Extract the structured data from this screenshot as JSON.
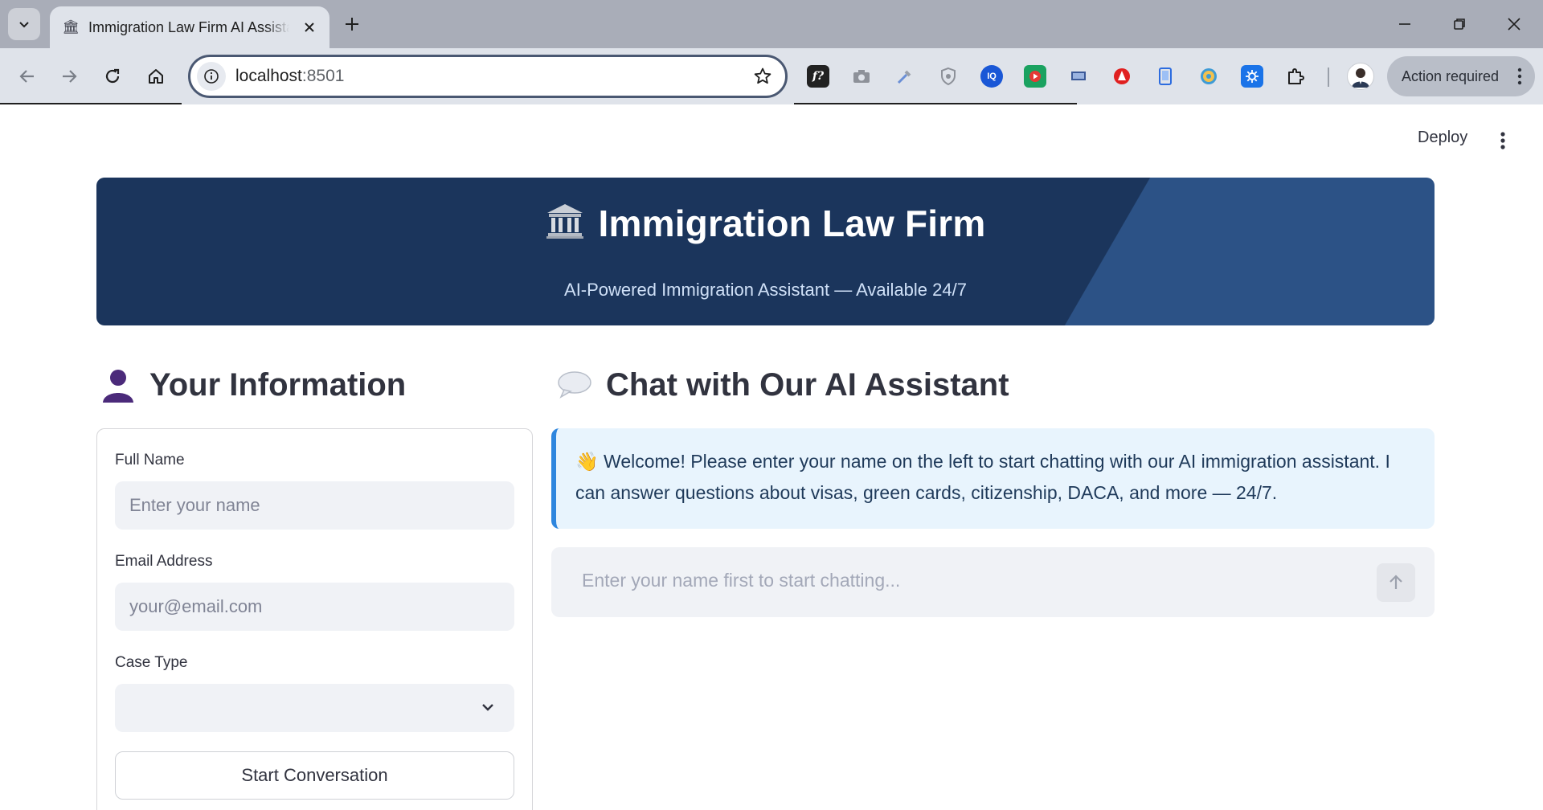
{
  "browser": {
    "tab_title": "Immigration Law Firm AI Assistant",
    "tab_favicon": "🏛",
    "url_host": "localhost",
    "url_port": ":8501",
    "action_required": "Action required",
    "extensions": [
      "formula-extension-icon",
      "camera-extension-icon",
      "eyedropper-extension-icon",
      "shield-extension-icon",
      "iq-extension-icon",
      "video-record-extension-icon",
      "screen-extension-icon",
      "pdf-extension-icon",
      "tablet-extension-icon",
      "cd-extension-icon",
      "gear-extension-icon",
      "puzzle-extensions-icon"
    ]
  },
  "app": {
    "deploy_label": "Deploy"
  },
  "banner": {
    "emoji": "🏛️",
    "title": "Immigration Law Firm",
    "subtitle": "AI-Powered Immigration Assistant — Available 24/7"
  },
  "info_section": {
    "heading": "Your Information",
    "name_label": "Full Name",
    "name_placeholder": "Enter your name",
    "email_label": "Email Address",
    "email_placeholder": "your@email.com",
    "case_label": "Case Type",
    "case_value": "",
    "start_button": "Start Conversation"
  },
  "chat_section": {
    "heading": "Chat with Our AI Assistant",
    "welcome_emoji": "👋",
    "welcome_text": "Welcome! Please enter your name on the left to start chatting with our AI immigration assistant. I can answer questions about visas, green cards, citizenship, DACA, and more — 24/7.",
    "input_placeholder": "Enter your name first to start chatting..."
  },
  "colors": {
    "banner_dark": "#1b355c",
    "banner_light": "#2c5286",
    "info_bg": "#e8f4fd",
    "info_accent": "#2e86de"
  }
}
